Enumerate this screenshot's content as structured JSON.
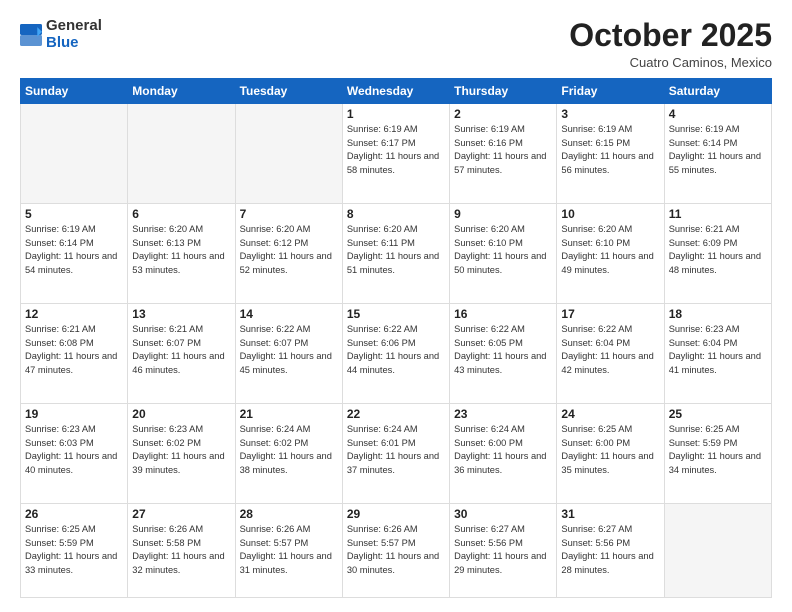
{
  "header": {
    "logo": {
      "line1": "General",
      "line2": "Blue"
    },
    "title": "October 2025",
    "location": "Cuatro Caminos, Mexico"
  },
  "days_of_week": [
    "Sunday",
    "Monday",
    "Tuesday",
    "Wednesday",
    "Thursday",
    "Friday",
    "Saturday"
  ],
  "weeks": [
    [
      {
        "day": "",
        "info": "",
        "empty": true
      },
      {
        "day": "",
        "info": "",
        "empty": true
      },
      {
        "day": "",
        "info": "",
        "empty": true
      },
      {
        "day": "1",
        "info": "Sunrise: 6:19 AM\nSunset: 6:17 PM\nDaylight: 11 hours\nand 58 minutes."
      },
      {
        "day": "2",
        "info": "Sunrise: 6:19 AM\nSunset: 6:16 PM\nDaylight: 11 hours\nand 57 minutes."
      },
      {
        "day": "3",
        "info": "Sunrise: 6:19 AM\nSunset: 6:15 PM\nDaylight: 11 hours\nand 56 minutes."
      },
      {
        "day": "4",
        "info": "Sunrise: 6:19 AM\nSunset: 6:14 PM\nDaylight: 11 hours\nand 55 minutes."
      }
    ],
    [
      {
        "day": "5",
        "info": "Sunrise: 6:19 AM\nSunset: 6:14 PM\nDaylight: 11 hours\nand 54 minutes."
      },
      {
        "day": "6",
        "info": "Sunrise: 6:20 AM\nSunset: 6:13 PM\nDaylight: 11 hours\nand 53 minutes."
      },
      {
        "day": "7",
        "info": "Sunrise: 6:20 AM\nSunset: 6:12 PM\nDaylight: 11 hours\nand 52 minutes."
      },
      {
        "day": "8",
        "info": "Sunrise: 6:20 AM\nSunset: 6:11 PM\nDaylight: 11 hours\nand 51 minutes."
      },
      {
        "day": "9",
        "info": "Sunrise: 6:20 AM\nSunset: 6:10 PM\nDaylight: 11 hours\nand 50 minutes."
      },
      {
        "day": "10",
        "info": "Sunrise: 6:20 AM\nSunset: 6:10 PM\nDaylight: 11 hours\nand 49 minutes."
      },
      {
        "day": "11",
        "info": "Sunrise: 6:21 AM\nSunset: 6:09 PM\nDaylight: 11 hours\nand 48 minutes."
      }
    ],
    [
      {
        "day": "12",
        "info": "Sunrise: 6:21 AM\nSunset: 6:08 PM\nDaylight: 11 hours\nand 47 minutes."
      },
      {
        "day": "13",
        "info": "Sunrise: 6:21 AM\nSunset: 6:07 PM\nDaylight: 11 hours\nand 46 minutes."
      },
      {
        "day": "14",
        "info": "Sunrise: 6:22 AM\nSunset: 6:07 PM\nDaylight: 11 hours\nand 45 minutes."
      },
      {
        "day": "15",
        "info": "Sunrise: 6:22 AM\nSunset: 6:06 PM\nDaylight: 11 hours\nand 44 minutes."
      },
      {
        "day": "16",
        "info": "Sunrise: 6:22 AM\nSunset: 6:05 PM\nDaylight: 11 hours\nand 43 minutes."
      },
      {
        "day": "17",
        "info": "Sunrise: 6:22 AM\nSunset: 6:04 PM\nDaylight: 11 hours\nand 42 minutes."
      },
      {
        "day": "18",
        "info": "Sunrise: 6:23 AM\nSunset: 6:04 PM\nDaylight: 11 hours\nand 41 minutes."
      }
    ],
    [
      {
        "day": "19",
        "info": "Sunrise: 6:23 AM\nSunset: 6:03 PM\nDaylight: 11 hours\nand 40 minutes."
      },
      {
        "day": "20",
        "info": "Sunrise: 6:23 AM\nSunset: 6:02 PM\nDaylight: 11 hours\nand 39 minutes."
      },
      {
        "day": "21",
        "info": "Sunrise: 6:24 AM\nSunset: 6:02 PM\nDaylight: 11 hours\nand 38 minutes."
      },
      {
        "day": "22",
        "info": "Sunrise: 6:24 AM\nSunset: 6:01 PM\nDaylight: 11 hours\nand 37 minutes."
      },
      {
        "day": "23",
        "info": "Sunrise: 6:24 AM\nSunset: 6:00 PM\nDaylight: 11 hours\nand 36 minutes."
      },
      {
        "day": "24",
        "info": "Sunrise: 6:25 AM\nSunset: 6:00 PM\nDaylight: 11 hours\nand 35 minutes."
      },
      {
        "day": "25",
        "info": "Sunrise: 6:25 AM\nSunset: 5:59 PM\nDaylight: 11 hours\nand 34 minutes."
      }
    ],
    [
      {
        "day": "26",
        "info": "Sunrise: 6:25 AM\nSunset: 5:59 PM\nDaylight: 11 hours\nand 33 minutes."
      },
      {
        "day": "27",
        "info": "Sunrise: 6:26 AM\nSunset: 5:58 PM\nDaylight: 11 hours\nand 32 minutes."
      },
      {
        "day": "28",
        "info": "Sunrise: 6:26 AM\nSunset: 5:57 PM\nDaylight: 11 hours\nand 31 minutes."
      },
      {
        "day": "29",
        "info": "Sunrise: 6:26 AM\nSunset: 5:57 PM\nDaylight: 11 hours\nand 30 minutes."
      },
      {
        "day": "30",
        "info": "Sunrise: 6:27 AM\nSunset: 5:56 PM\nDaylight: 11 hours\nand 29 minutes."
      },
      {
        "day": "31",
        "info": "Sunrise: 6:27 AM\nSunset: 5:56 PM\nDaylight: 11 hours\nand 28 minutes."
      },
      {
        "day": "",
        "info": "",
        "empty": true
      }
    ]
  ]
}
